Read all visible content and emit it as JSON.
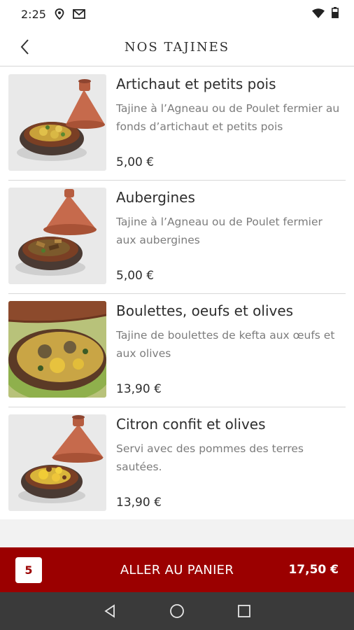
{
  "status_bar": {
    "time": "2:25",
    "icons": [
      "location-icon",
      "gmail-icon",
      "wifi-icon",
      "battery-icon"
    ]
  },
  "header": {
    "title": "NOS TAJINES",
    "back_icon": "chevron-left-icon"
  },
  "items": [
    {
      "name": "Artichaut et petits pois",
      "description": "Tajine à l’Agneau ou de Poulet fermier au fonds d’artichaut et petits pois",
      "price": "5,00 €"
    },
    {
      "name": "Aubergines",
      "description": "Tajine à l’Agneau ou de Poulet fermier aux aubergines",
      "price": "5,00 €"
    },
    {
      "name": "Boulettes, oeufs et olives",
      "description": "Tajine de boulettes de kefta aux œufs et aux olives",
      "price": "13,90 €"
    },
    {
      "name": "Citron confit et olives",
      "description": "Servi avec des pommes des terres sautées.",
      "price": "13,90 €"
    }
  ],
  "cart": {
    "count": "5",
    "label": "ALLER AU PANIER",
    "total": "17,50 €"
  },
  "colors": {
    "accent": "#9b0000",
    "nav_bar": "#3a3a3a"
  },
  "nav_bar": {
    "icons": [
      "back-triangle-icon",
      "home-circle-icon",
      "recents-square-icon"
    ]
  }
}
